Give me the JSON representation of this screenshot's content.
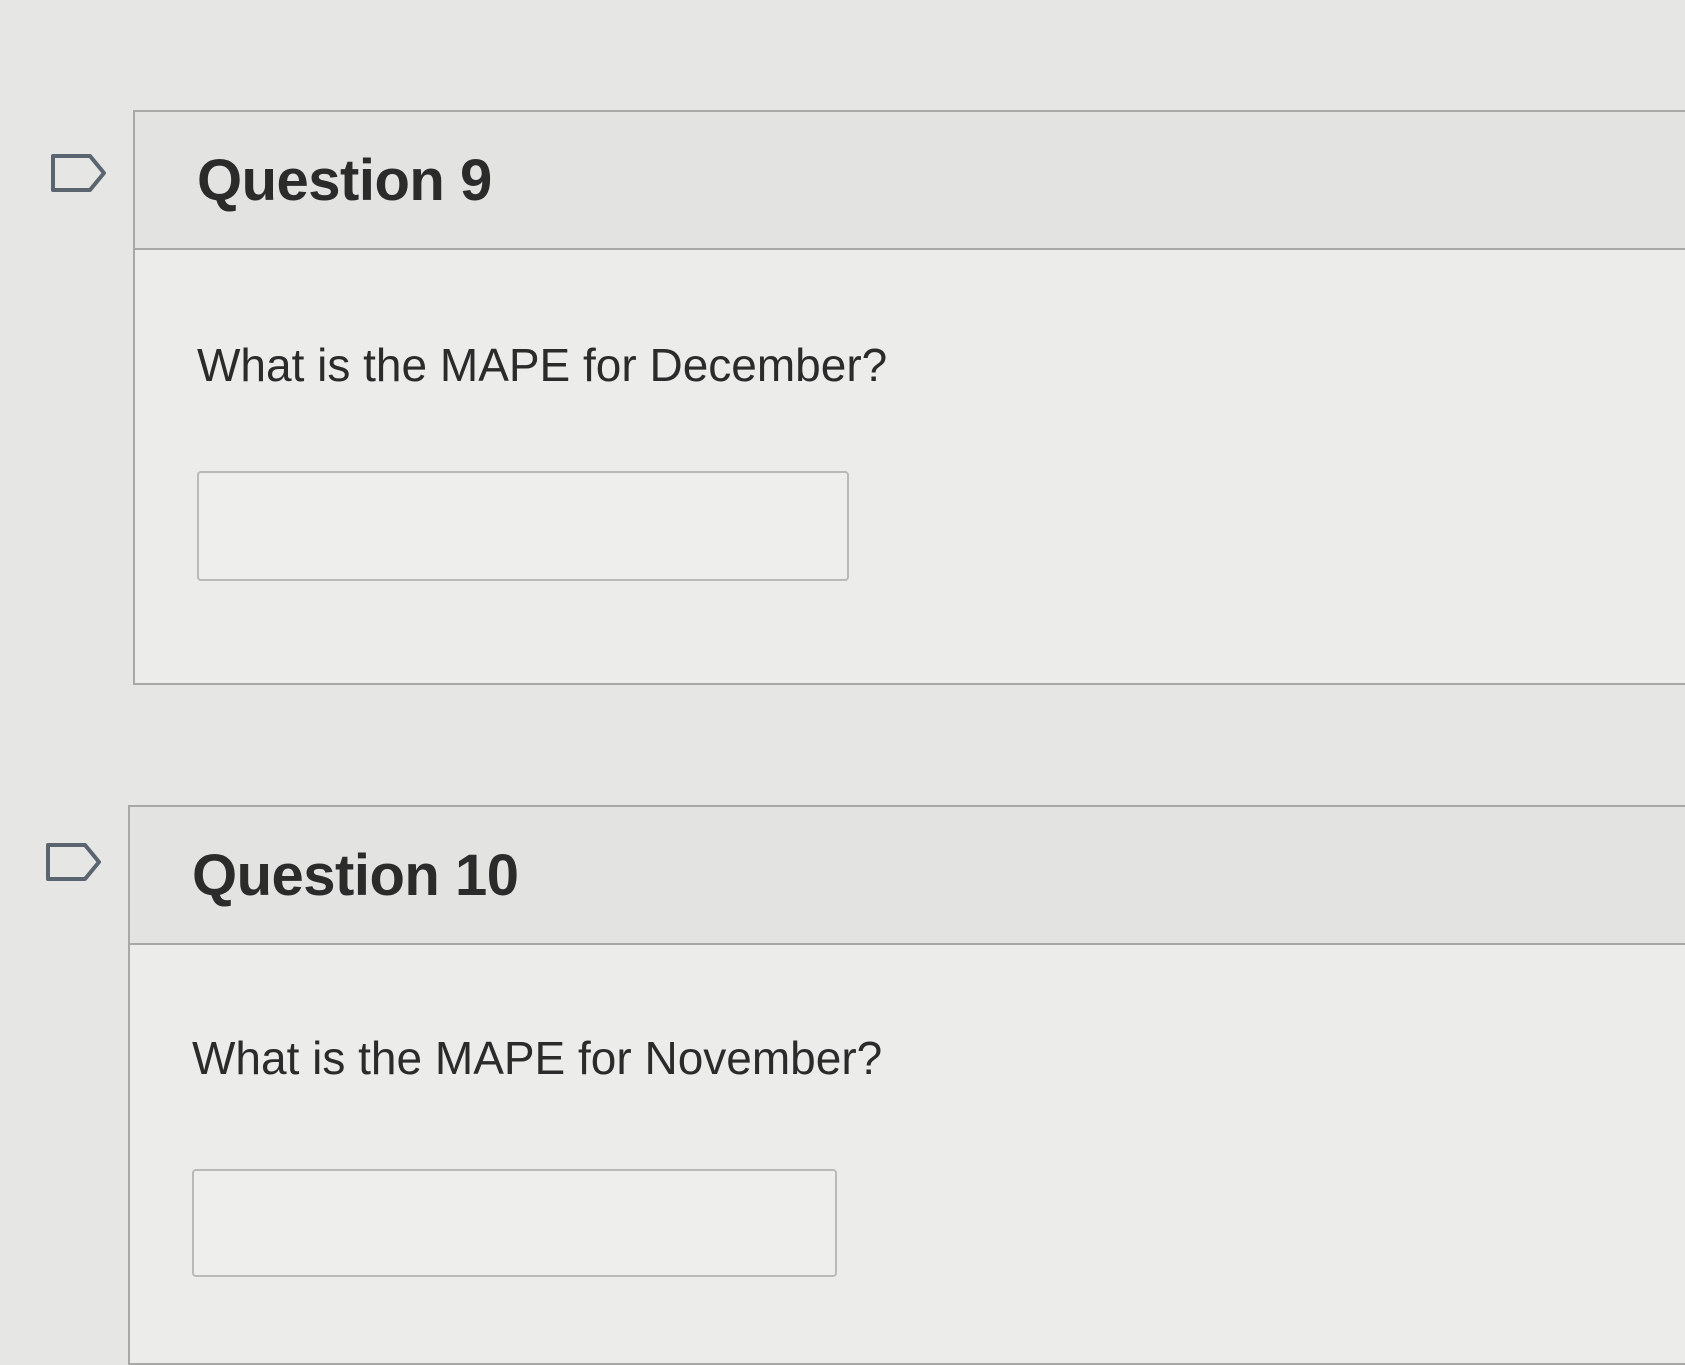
{
  "questions": [
    {
      "title": "Question 9",
      "text": "What is the MAPE for December?",
      "answer_value": ""
    },
    {
      "title": "Question 10",
      "text": "What is the MAPE for November?",
      "answer_value": ""
    }
  ],
  "icons": {
    "flag": "flag-question-icon"
  },
  "colors": {
    "background": "#e6e6e4",
    "header_background": "#e3e3e1",
    "border": "#a8a8a6",
    "text": "#2b2b2b"
  }
}
